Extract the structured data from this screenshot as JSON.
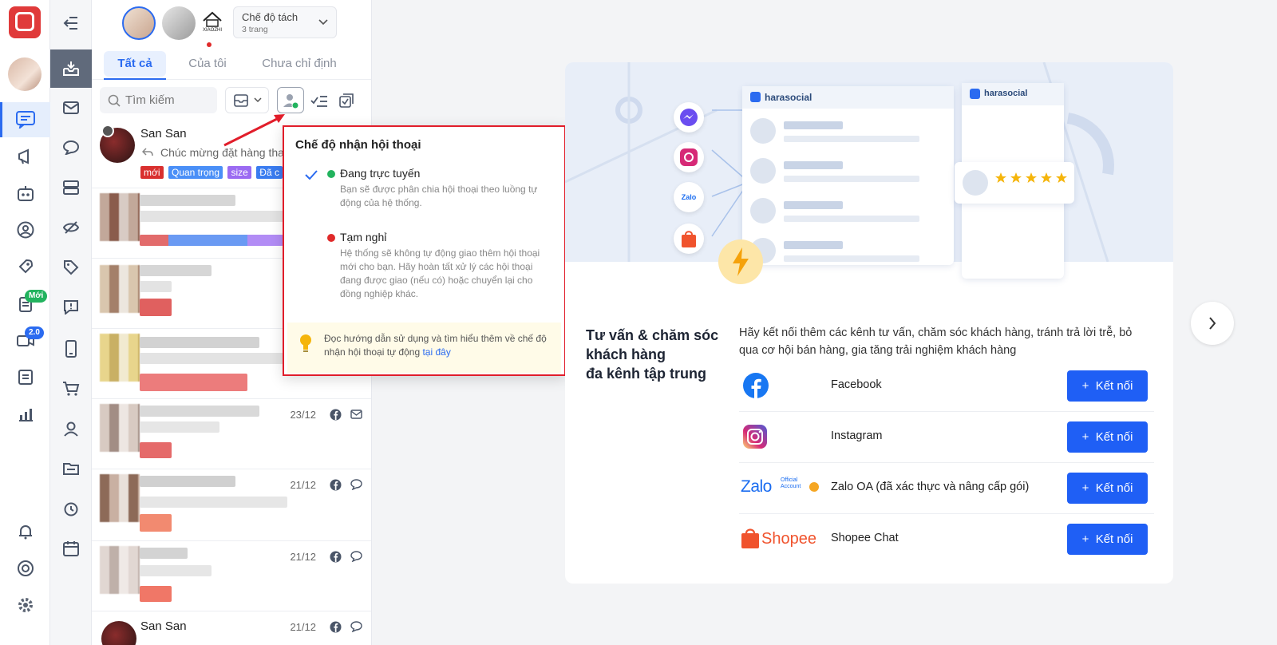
{
  "pages_header": {
    "mode_label": "Chế độ tách",
    "mode_sub": "3 trang",
    "page3_caption": "XIAOZHI"
  },
  "tabs": [
    "Tất cả",
    "Của tôi",
    "Chưa chỉ định"
  ],
  "search_placeholder": "Tìm kiếm",
  "rail_badges": {
    "new": "Mới",
    "version": "2.0"
  },
  "first_conversation": {
    "name": "San San",
    "preview": "Chúc mừng đặt hàng tha",
    "tags": [
      {
        "label": "mới",
        "color": "#d9302f"
      },
      {
        "label": "Quan trọng",
        "color": "#4a8ff7"
      },
      {
        "label": "size",
        "color": "#9b6bf2"
      },
      {
        "label": "Đã c",
        "color": "#3a7cf0"
      }
    ]
  },
  "conversation_dates": [
    "23/12",
    "21/12",
    "21/12",
    "21/12"
  ],
  "last_conversation_name": "San San",
  "popup": {
    "title": "Chế độ nhận hội thoại",
    "online_title": "Đang trực tuyến",
    "online_desc": "Bạn sẽ được phân chia hội thoại theo luồng tự động của hệ thống.",
    "pause_title": "Tạm nghỉ",
    "pause_desc": "Hệ thống sẽ không tự động giao thêm hội thoại mới cho bạn. Hãy hoàn tất xử lý các hội thoại đang được giao (nếu có) hoặc chuyển lại cho đồng nghiệp khác.",
    "tip_text": "Đọc hướng dẫn sử dụng và tìm hiểu thêm về chế độ nhận hội thoại tự động ",
    "tip_link": "tại đây"
  },
  "hero": {
    "brand": "harasocial",
    "zalo_icon": "Zalo"
  },
  "main": {
    "headline_lines": [
      "Tư vấn & chăm sóc",
      "khách hàng",
      "đa kênh tập trung"
    ],
    "subtext": "Hãy kết nối thêm các kênh tư vấn, chăm sóc khách hàng, tránh trả lời trễ, bỏ qua cơ hội bán hàng, gia tăng trải nghiệm khách hàng",
    "channels": [
      {
        "name": "Facebook",
        "logo_text": ""
      },
      {
        "name": "Instagram",
        "logo_text": ""
      },
      {
        "name": "Zalo OA (đã xác thực và nâng cấp gói)",
        "logo_text": "Zalo",
        "logo_sub": "Official Account"
      },
      {
        "name": "Shopee Chat",
        "logo_text": "Shopee"
      }
    ],
    "connect_label": "Kết nối",
    "connect_icon": "+"
  },
  "colors": {
    "primary": "#1f5ff5",
    "popup_border": "#e11d2a",
    "online": "#22b35e",
    "pause": "#e02a2a"
  }
}
